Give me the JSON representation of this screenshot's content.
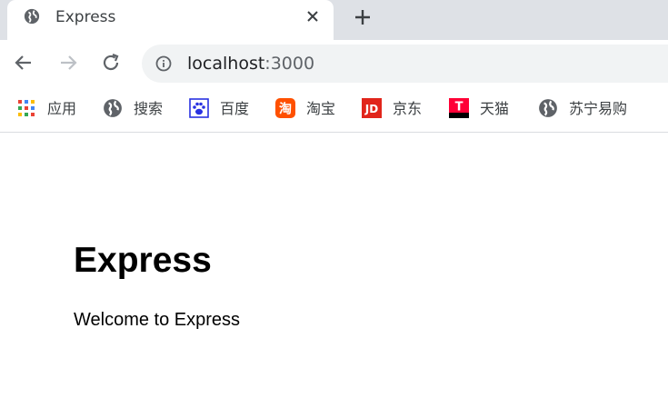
{
  "tab": {
    "title": "Express",
    "favicon": "globe-icon"
  },
  "address_bar": {
    "host": "localhost",
    "port": ":3000"
  },
  "bookmarks": [
    {
      "label": "应用",
      "icon": "apps-grid-icon"
    },
    {
      "label": "搜索",
      "icon": "globe-icon"
    },
    {
      "label": "百度",
      "icon": "baidu-paw-icon"
    },
    {
      "label": "淘宝",
      "icon": "taobao-icon",
      "icon_text": "淘"
    },
    {
      "label": "京东",
      "icon": "jd-icon",
      "icon_text": "JD"
    },
    {
      "label": "天猫",
      "icon": "tmall-icon",
      "icon_text": "T"
    },
    {
      "label": "苏宁易购",
      "icon": "globe-icon"
    }
  ],
  "page": {
    "heading": "Express",
    "text": "Welcome to Express"
  },
  "colors": {
    "tabstrip": "#dee1e6",
    "omnibox": "#f1f3f4",
    "taobao": "#ff5000",
    "jd": "#e1251b",
    "tmall": "#ff0036",
    "baidu": "#2932e1"
  }
}
